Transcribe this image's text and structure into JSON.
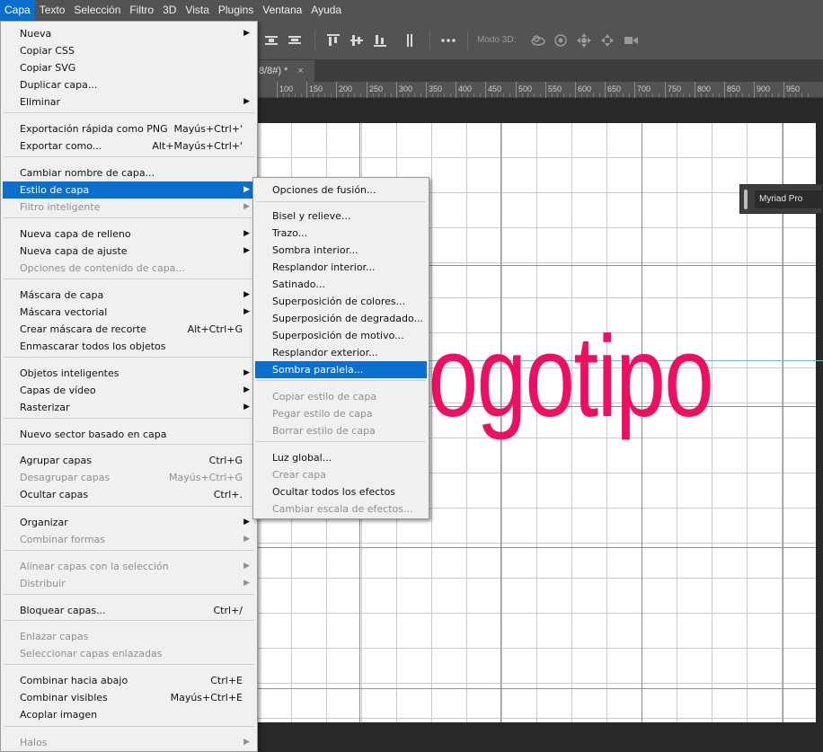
{
  "menubar": [
    "Capa",
    "Texto",
    "Selección",
    "Filtro",
    "3D",
    "Vista",
    "Plugins",
    "Ventana",
    "Ayuda"
  ],
  "options_bar": {
    "modo3d_label": "Modo 3D:"
  },
  "document_tab": {
    "title": "8/8#) *",
    "close": "×"
  },
  "ruler_labels": [
    "100",
    "150",
    "200",
    "250",
    "300",
    "350",
    "400",
    "450",
    "500",
    "550",
    "600",
    "650",
    "700",
    "750",
    "800",
    "850",
    "900",
    "950"
  ],
  "canvas": {
    "logo_text": "logotipo",
    "text_color": "#ef0e61"
  },
  "font_panel": {
    "font_name": "Myriad Pro"
  },
  "main_menu": {
    "items": [
      {
        "label": "Nueva",
        "shortcut": "",
        "submenu": true,
        "disabled": false
      },
      {
        "label": "Copiar CSS",
        "shortcut": "",
        "submenu": false,
        "disabled": false
      },
      {
        "label": "Copiar SVG",
        "shortcut": "",
        "submenu": false,
        "disabled": false
      },
      {
        "label": "Duplicar capa...",
        "shortcut": "",
        "submenu": false,
        "disabled": false
      },
      {
        "label": "Eliminar",
        "shortcut": "",
        "submenu": true,
        "disabled": false
      },
      {
        "label": "Exportación rápida como PNG",
        "shortcut": "Mayús+Ctrl+'",
        "submenu": false,
        "disabled": false
      },
      {
        "label": "Exportar como...",
        "shortcut": "Alt+Mayús+Ctrl+'",
        "submenu": false,
        "disabled": false
      },
      {
        "label": "Cambiar nombre de capa...",
        "shortcut": "",
        "submenu": false,
        "disabled": false
      },
      {
        "label": "Estilo de capa",
        "shortcut": "",
        "submenu": true,
        "disabled": false,
        "highlighted": true
      },
      {
        "label": "Filtro inteligente",
        "shortcut": "",
        "submenu": true,
        "disabled": true
      },
      {
        "label": "Nueva capa de relleno",
        "shortcut": "",
        "submenu": true,
        "disabled": false
      },
      {
        "label": "Nueva capa de ajuste",
        "shortcut": "",
        "submenu": true,
        "disabled": false
      },
      {
        "label": "Opciones de contenido de capa...",
        "shortcut": "",
        "submenu": false,
        "disabled": true
      },
      {
        "label": "Máscara de capa",
        "shortcut": "",
        "submenu": true,
        "disabled": false
      },
      {
        "label": "Máscara vectorial",
        "shortcut": "",
        "submenu": true,
        "disabled": false
      },
      {
        "label": "Crear máscara de recorte",
        "shortcut": "Alt+Ctrl+G",
        "submenu": false,
        "disabled": false
      },
      {
        "label": "Enmascarar todos los objetos",
        "shortcut": "",
        "submenu": false,
        "disabled": false
      },
      {
        "label": "Objetos inteligentes",
        "shortcut": "",
        "submenu": true,
        "disabled": false
      },
      {
        "label": "Capas de vídeo",
        "shortcut": "",
        "submenu": true,
        "disabled": false
      },
      {
        "label": "Rasterizar",
        "shortcut": "",
        "submenu": true,
        "disabled": false
      },
      {
        "label": "Nuevo sector basado en capa",
        "shortcut": "",
        "submenu": false,
        "disabled": false
      },
      {
        "label": "Agrupar capas",
        "shortcut": "Ctrl+G",
        "submenu": false,
        "disabled": false
      },
      {
        "label": "Desagrupar capas",
        "shortcut": "Mayús+Ctrl+G",
        "submenu": false,
        "disabled": true
      },
      {
        "label": "Ocultar capas",
        "shortcut": "Ctrl+.",
        "submenu": false,
        "disabled": false
      },
      {
        "label": "Organizar",
        "shortcut": "",
        "submenu": true,
        "disabled": false
      },
      {
        "label": "Combinar formas",
        "shortcut": "",
        "submenu": true,
        "disabled": true
      },
      {
        "label": "Alinear capas con la selección",
        "shortcut": "",
        "submenu": true,
        "disabled": true
      },
      {
        "label": "Distribuir",
        "shortcut": "",
        "submenu": true,
        "disabled": true
      },
      {
        "label": "Bloquear capas...",
        "shortcut": "Ctrl+/",
        "submenu": false,
        "disabled": false
      },
      {
        "label": "Enlazar capas",
        "shortcut": "",
        "submenu": false,
        "disabled": true
      },
      {
        "label": "Seleccionar capas enlazadas",
        "shortcut": "",
        "submenu": false,
        "disabled": true
      },
      {
        "label": "Combinar hacia abajo",
        "shortcut": "Ctrl+E",
        "submenu": false,
        "disabled": false
      },
      {
        "label": "Combinar visibles",
        "shortcut": "Mayús+Ctrl+E",
        "submenu": false,
        "disabled": false
      },
      {
        "label": "Acoplar imagen",
        "shortcut": "",
        "submenu": false,
        "disabled": false
      },
      {
        "label": "Halos",
        "shortcut": "",
        "submenu": true,
        "disabled": true
      }
    ]
  },
  "sub_menu": {
    "items": [
      {
        "label": "Opciones de fusión...",
        "disabled": false
      },
      {
        "label": "Bisel y relieve...",
        "disabled": false
      },
      {
        "label": "Trazo...",
        "disabled": false
      },
      {
        "label": "Sombra interior...",
        "disabled": false
      },
      {
        "label": "Resplandor interior...",
        "disabled": false
      },
      {
        "label": "Satinado...",
        "disabled": false
      },
      {
        "label": "Superposición de colores...",
        "disabled": false
      },
      {
        "label": "Superposición de degradado...",
        "disabled": false
      },
      {
        "label": "Superposición de motivo...",
        "disabled": false
      },
      {
        "label": "Resplandor exterior...",
        "disabled": false
      },
      {
        "label": "Sombra paralela...",
        "disabled": false,
        "highlighted": true
      },
      {
        "label": "Copiar estilo de capa",
        "disabled": true
      },
      {
        "label": "Pegar estilo de capa",
        "disabled": true
      },
      {
        "label": "Borrar estilo de capa",
        "disabled": true
      },
      {
        "label": "Luz global...",
        "disabled": false
      },
      {
        "label": "Crear capa",
        "disabled": true
      },
      {
        "label": "Ocultar todos los efectos",
        "disabled": false
      },
      {
        "label": "Cambiar escala de efectos...",
        "disabled": true
      }
    ]
  },
  "colors": {
    "highlight": "#0b6fd0",
    "menu_bg": "#f0f0f0",
    "chrome": "#535353",
    "guide": "#33d6e8"
  }
}
